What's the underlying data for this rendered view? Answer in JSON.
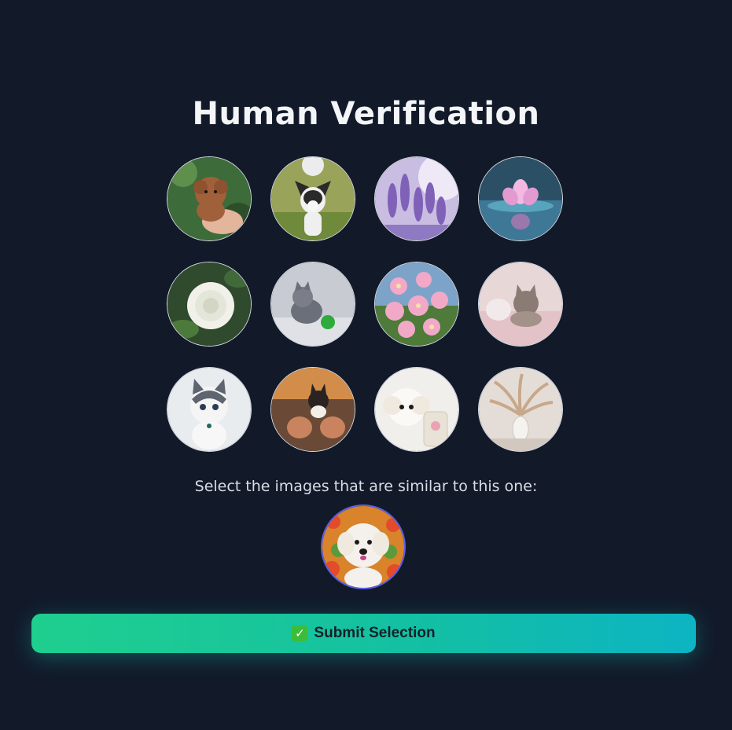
{
  "title": "Human Verification",
  "grid": {
    "images": [
      {
        "name": "puppy-in-hand",
        "bg": "#3d6b3a",
        "fg": "#a0603a"
      },
      {
        "name": "chihuahua",
        "bg": "#9aa35a",
        "fg": "#2a2a2a"
      },
      {
        "name": "lavender",
        "bg": "#b7a6d6",
        "fg": "#7f62b8"
      },
      {
        "name": "lotus",
        "bg": "#2b5066",
        "fg": "#e39ad1"
      },
      {
        "name": "white-rose",
        "bg": "#2f4a2c",
        "fg": "#f1f1ea"
      },
      {
        "name": "kitten-with-ball",
        "bg": "#c8cbd2",
        "fg": "#6b6f79"
      },
      {
        "name": "pink-daisies",
        "bg": "#7da3c9",
        "fg": "#f1a9c7"
      },
      {
        "name": "kitten-on-blanket",
        "bg": "#e8d7d7",
        "fg": "#8a7c74"
      },
      {
        "name": "gray-white-kitten",
        "bg": "#e9ecef",
        "fg": "#5e6470"
      },
      {
        "name": "kitten-on-eggs",
        "bg": "#6a4a36",
        "fg": "#2a2321"
      },
      {
        "name": "white-puppy-phone",
        "bg": "#f1efec",
        "fg": "#e9e2d6"
      },
      {
        "name": "pampas-vase",
        "bg": "#e4ddd7",
        "fg": "#c8a88a"
      }
    ]
  },
  "prompt": "Select the images that are similar to this one:",
  "reference": {
    "name": "white-puppy-flowers",
    "bg": "#d9832a",
    "fg": "#f4f1ec"
  },
  "submit": {
    "icon": "✓",
    "label": "Submit Selection"
  },
  "colors": {
    "background": "#121a2a",
    "button_start": "#1fcf8e",
    "button_end": "#0db4c3",
    "reference_border": "#5b5fe6"
  }
}
